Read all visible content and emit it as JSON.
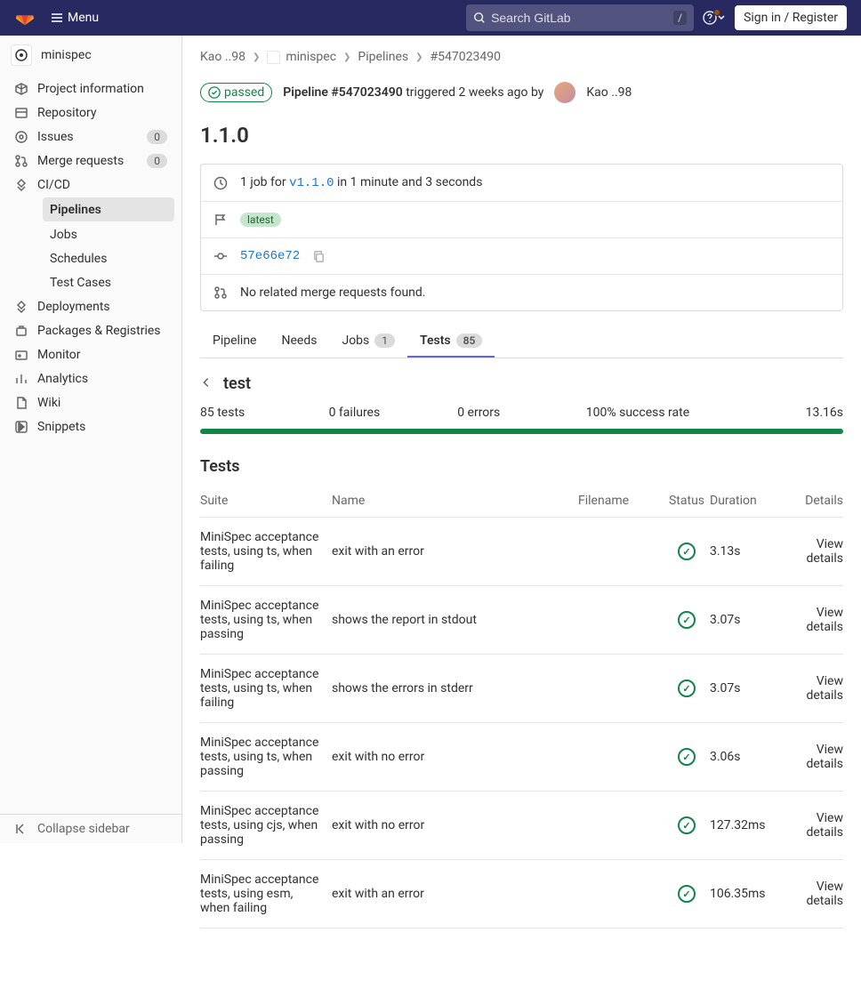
{
  "topbar": {
    "menu_label": "Menu",
    "search_placeholder": "Search GitLab",
    "search_key": "/",
    "signin_label": "Sign in / Register"
  },
  "sidebar": {
    "project_name": "minispec",
    "items": [
      {
        "label": "Project information"
      },
      {
        "label": "Repository"
      },
      {
        "label": "Issues",
        "badge": "0"
      },
      {
        "label": "Merge requests",
        "badge": "0"
      },
      {
        "label": "CI/CD",
        "expanded": true,
        "children": [
          {
            "label": "Pipelines",
            "active": true
          },
          {
            "label": "Jobs"
          },
          {
            "label": "Schedules"
          },
          {
            "label": "Test Cases"
          }
        ]
      },
      {
        "label": "Deployments"
      },
      {
        "label": "Packages & Registries"
      },
      {
        "label": "Monitor"
      },
      {
        "label": "Analytics"
      },
      {
        "label": "Wiki"
      },
      {
        "label": "Snippets"
      }
    ],
    "collapse_label": "Collapse sidebar"
  },
  "breadcrumbs": {
    "owner": "Kao ..98",
    "project": "minispec",
    "section": "Pipelines",
    "id": "#547023490"
  },
  "pipeline": {
    "status": "passed",
    "title": "Pipeline #547023490",
    "triggered_text": "triggered",
    "time_ago": "2 weeks ago",
    "by_text": "by",
    "user": "Kao ..98",
    "version": "1.1.0",
    "job_text_prefix": "1 job for",
    "ref": "v1.1.0",
    "job_text_suffix": "in 1 minute and 3 seconds",
    "latest_tag": "latest",
    "commit": "57e66e72",
    "merge_request_text": "No related merge requests found."
  },
  "tabs": [
    {
      "label": "Pipeline"
    },
    {
      "label": "Needs"
    },
    {
      "label": "Jobs",
      "badge": "1"
    },
    {
      "label": "Tests",
      "badge": "85",
      "active": true
    }
  ],
  "summary": {
    "title": "test",
    "stats": [
      {
        "label": "85 tests"
      },
      {
        "label": "0 failures"
      },
      {
        "label": "0 errors"
      },
      {
        "label": "100% success rate"
      },
      {
        "label": "13.16s",
        "right": true
      }
    ]
  },
  "tests_heading": "Tests",
  "columns": {
    "suite": "Suite",
    "name": "Name",
    "filename": "Filename",
    "status": "Status",
    "duration": "Duration",
    "details": "Details"
  },
  "view_details_label": "View details",
  "tests": [
    {
      "suite": "MiniSpec acceptance tests, using ts, when failing",
      "name": "exit with an error",
      "duration": "3.13s"
    },
    {
      "suite": "MiniSpec acceptance tests, using ts, when passing",
      "name": "shows the report in stdout",
      "duration": "3.07s"
    },
    {
      "suite": "MiniSpec acceptance tests, using ts, when failing",
      "name": "shows the errors in stderr",
      "duration": "3.07s"
    },
    {
      "suite": "MiniSpec acceptance tests, using ts, when passing",
      "name": "exit with no error",
      "duration": "3.06s"
    },
    {
      "suite": "MiniSpec acceptance tests, using cjs, when passing",
      "name": "exit with no error",
      "duration": "127.32ms"
    },
    {
      "suite": "MiniSpec acceptance tests, using esm, when failing",
      "name": "exit with an error",
      "duration": "106.35ms"
    }
  ]
}
